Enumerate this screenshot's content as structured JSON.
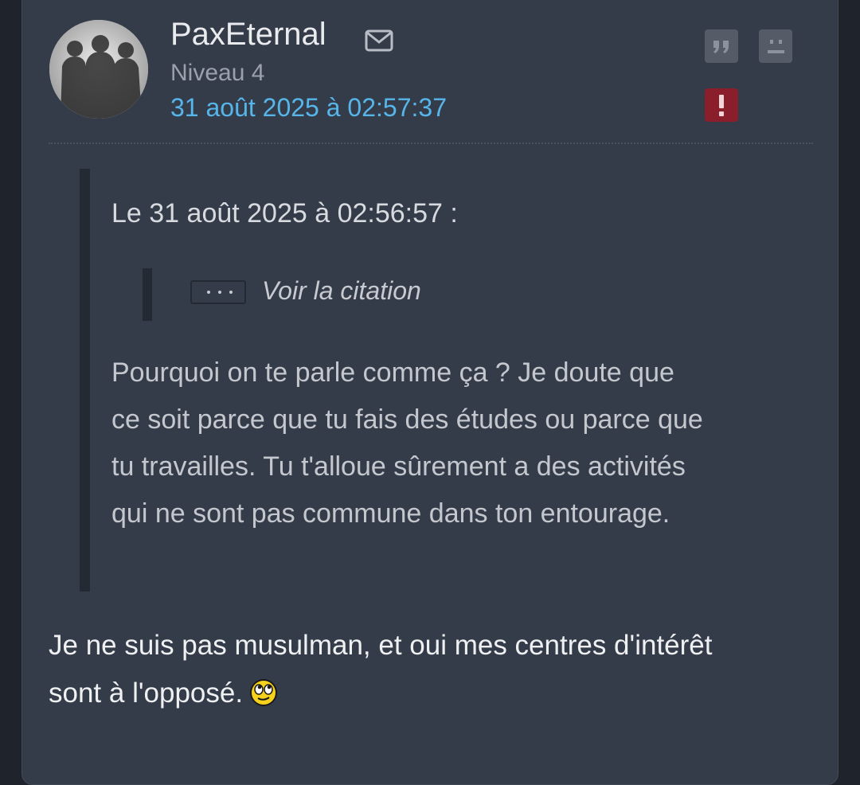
{
  "author": {
    "pseudo": "PaxEternal",
    "level": "Niveau 4",
    "date": "31 août 2025 à 02:57:37",
    "avatar_icon": "avatar-three-silhouettes",
    "mail_icon": "envelope-icon"
  },
  "actions": {
    "quote_icon": "quote-icon",
    "mp_icon": "sad-face-icon",
    "report_icon": "exclamation-icon",
    "report_color": "#8a1f2b",
    "button_color": "#555c67"
  },
  "quote": {
    "header": "Le 31 août 2025 à 02:56:57 :",
    "nested_label": "Voir la citation",
    "nested_button_icon": "ellipsis-icon",
    "body_lines": [
      "Pourquoi on te parle comme ça ? Je doute que",
      "ce soit parce que tu fais des études ou parce que",
      "tu travailles. Tu t'alloue sûrement a des activités",
      "qui ne sont pas commune dans ton entourage."
    ]
  },
  "message": {
    "lines": [
      "Je ne suis pas musulman, et oui mes centres d'intérêt",
      "sont à l'opposé."
    ],
    "smiley_icon": "eye-roll-smiley-icon"
  },
  "colors": {
    "background": "#1f242c",
    "card": "#353c49",
    "date_link": "#56b6ea",
    "quote_border": "#242a33"
  }
}
